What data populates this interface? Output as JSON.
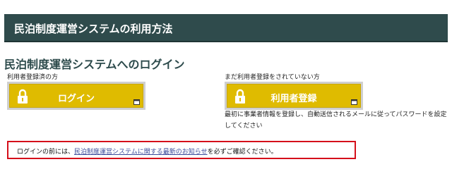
{
  "banner": {
    "title": "民泊制度運営システムの利用方法"
  },
  "login_section": {
    "heading": "民泊制度運営システムへのログイン"
  },
  "left": {
    "caption": "利用者登録済の方",
    "button_label": "ログイン"
  },
  "right": {
    "caption": "まだ利用者登録をされていない方",
    "button_label": "利用者登録",
    "note": "最初に事業者情報を登録し、自動送信されるメールに従ってパスワードを設定してください"
  },
  "notice": {
    "prefix": "ログインの前には、",
    "link_text": "民泊制度運営システムに関する最新のお知らせ",
    "suffix": "を必ずご確認ください。"
  },
  "icons": {
    "lock": "lock-icon",
    "new_window": "new-window-icon"
  },
  "colors": {
    "banner_bg": "#2f4b4c",
    "button_yellow": "#dfbb00",
    "notice_border": "#d50f1a",
    "link": "#3a4a9a"
  }
}
